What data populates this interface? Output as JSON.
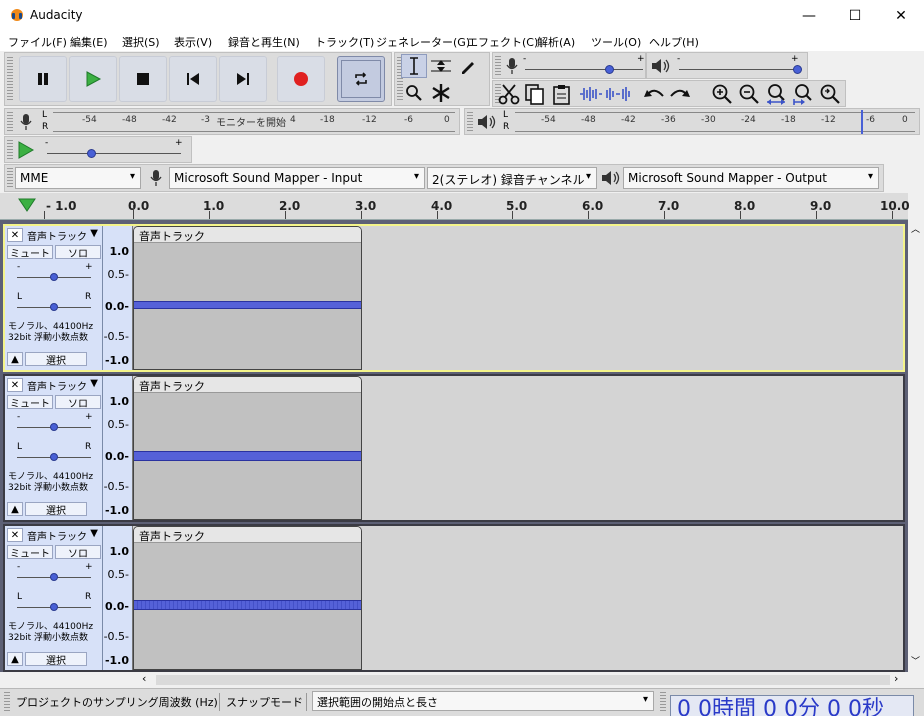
{
  "window": {
    "title": "Audacity",
    "minimize": "—",
    "maximize": "☐",
    "close": "✕"
  },
  "menu": [
    "ファイル(F)",
    "編集(E)",
    "選択(S)",
    "表示(V)",
    "録音と再生(N)",
    "トラック(T)",
    "ジェネレーター(G)",
    "エフェクト(C)",
    "解析(A)",
    "ツール(O)",
    "ヘルプ(H)"
  ],
  "transport": {
    "pause": "pause-icon",
    "play": "play-icon",
    "stop": "stop-icon",
    "skip_start": "skip-to-start-icon",
    "skip_end": "skip-to-end-icon",
    "record": "record-icon",
    "loop": "loop-icon"
  },
  "meters": {
    "rec_ticks": [
      "-54",
      "-48",
      "-42",
      "-3",
      "-18",
      "-12",
      "-6",
      "0"
    ],
    "rec_monitor": "モニターを開始",
    "rec_monitor_suffix": "4",
    "play_ticks": [
      "-54",
      "-48",
      "-42",
      "-36",
      "-30",
      "-24",
      "-18",
      "-12",
      "-6",
      "0"
    ],
    "L": "L",
    "R": "R"
  },
  "mixer": {
    "minus": "-",
    "plus": "+"
  },
  "device": {
    "host": "MME",
    "input": "Microsoft Sound Mapper - Input",
    "channels": "2(ステレオ) 録音チャンネル",
    "output": "Microsoft Sound Mapper - Output"
  },
  "timeline": {
    "labels": [
      "- 1.0",
      "0.0",
      "1.0",
      "2.0",
      "3.0",
      "4.0",
      "5.0",
      "6.0",
      "7.0",
      "8.0",
      "9.0",
      "10.0"
    ]
  },
  "tracks": [
    {
      "name": "音声トラック",
      "clip_name": "音声トラック",
      "mute": "ミュート",
      "solo": "ソロ",
      "select": "選択",
      "info1": "モノラル、44100Hz",
      "info2": "32bit 浮動小数点数",
      "scale": [
        "1.0",
        "0.5-",
        "0.0-",
        "-0.5-",
        "-1.0"
      ],
      "close": "✕",
      "focused": true
    },
    {
      "name": "音声トラック",
      "clip_name": "音声トラック",
      "mute": "ミュート",
      "solo": "ソロ",
      "select": "選択",
      "info1": "モノラル、44100Hz",
      "info2": "32bit 浮動小数点数",
      "scale": [
        "1.0",
        "0.5-",
        "0.0-",
        "-0.5-",
        "-1.0"
      ],
      "close": "✕",
      "focused": false
    },
    {
      "name": "音声トラック",
      "clip_name": "音声トラック",
      "mute": "ミュート",
      "solo": "ソロ",
      "select": "選択",
      "info1": "モノラル、44100Hz",
      "info2": "32bit 浮動小数点数",
      "scale": [
        "1.0",
        "0.5-",
        "0.0-",
        "-0.5-",
        "-1.0"
      ],
      "close": "✕",
      "focused": false
    }
  ],
  "bottom": {
    "rate_label": "プロジェクトのサンプリング周波数 (Hz)",
    "snap_label": "スナップモード",
    "selection_label": "選択範囲の開始点と長さ",
    "time_display": "0 0時間 0 0分 0 0秒"
  },
  "colors": {
    "accent": "#4860d6",
    "waveform": "#5561d8",
    "focus": "#f4f48a",
    "record": "#e02020",
    "play": "#3cb043"
  }
}
